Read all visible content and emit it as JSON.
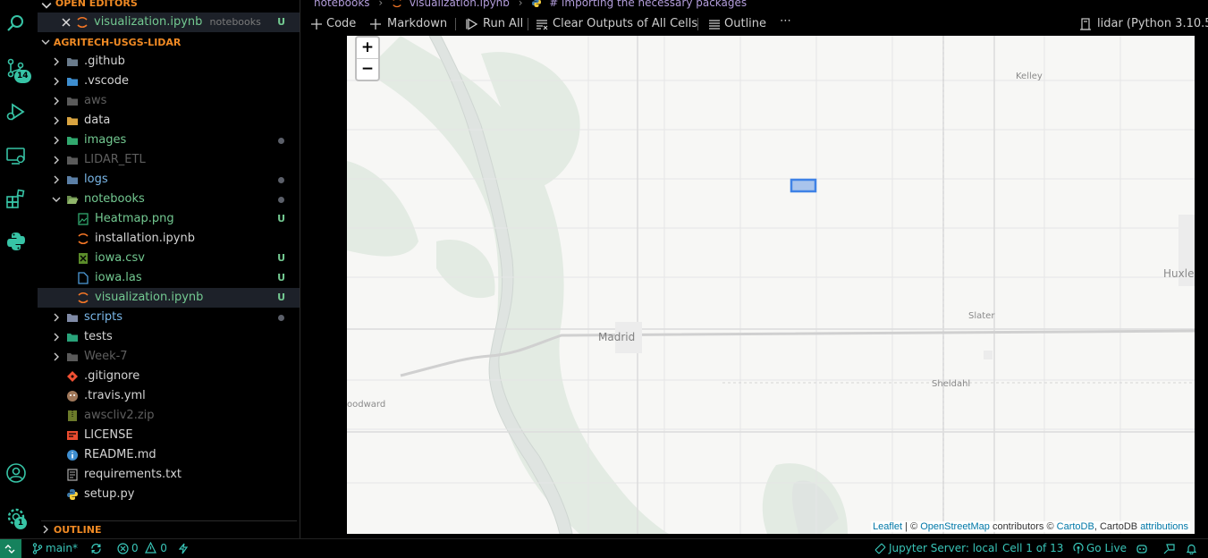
{
  "sidebar": {
    "open_editors_header": "OPEN EDITORS",
    "open_editor": {
      "name": "visualization.ipynb",
      "folder": "notebooks",
      "status": "U"
    },
    "project_header": "AGRITECH-USGS-LIDAR",
    "items": [
      {
        "label": ".github",
        "kind": "folder",
        "color": "white",
        "mark": ""
      },
      {
        "label": ".vscode",
        "kind": "folder",
        "color": "white",
        "mark": ""
      },
      {
        "label": "aws",
        "kind": "folder",
        "color": "dim",
        "mark": ""
      },
      {
        "label": "data",
        "kind": "folder",
        "color": "white",
        "mark": ""
      },
      {
        "label": "images",
        "kind": "folder",
        "color": "green",
        "mark": "dot"
      },
      {
        "label": "LIDAR_ETL",
        "kind": "folder",
        "color": "dim",
        "mark": ""
      },
      {
        "label": "logs",
        "kind": "folder",
        "color": "blue",
        "mark": "dot"
      },
      {
        "label": "notebooks",
        "kind": "folder-open",
        "color": "green",
        "mark": "dot"
      },
      {
        "label": "Heatmap.png",
        "kind": "file-image",
        "color": "green",
        "mark": "U"
      },
      {
        "label": "installation.ipynb",
        "kind": "file-notebook",
        "color": "white",
        "mark": ""
      },
      {
        "label": "iowa.csv",
        "kind": "file-csv",
        "color": "green",
        "mark": "U"
      },
      {
        "label": "iowa.las",
        "kind": "file-generic",
        "color": "green",
        "mark": "U"
      },
      {
        "label": "visualization.ipynb",
        "kind": "file-notebook",
        "color": "green",
        "mark": "U"
      },
      {
        "label": "scripts",
        "kind": "folder",
        "color": "blue",
        "mark": "dot"
      },
      {
        "label": "tests",
        "kind": "folder",
        "color": "white",
        "mark": ""
      },
      {
        "label": "Week-7",
        "kind": "folder",
        "color": "dim",
        "mark": ""
      },
      {
        "label": ".gitignore",
        "kind": "file-git",
        "color": "white",
        "mark": ""
      },
      {
        "label": ".travis.yml",
        "kind": "file-travis",
        "color": "white",
        "mark": ""
      },
      {
        "label": "awscliv2.zip",
        "kind": "file-zip",
        "color": "dim",
        "mark": ""
      },
      {
        "label": "LICENSE",
        "kind": "file-license",
        "color": "white",
        "mark": ""
      },
      {
        "label": "README.md",
        "kind": "file-info",
        "color": "white",
        "mark": ""
      },
      {
        "label": "requirements.txt",
        "kind": "file-text",
        "color": "white",
        "mark": ""
      },
      {
        "label": "setup.py",
        "kind": "file-python",
        "color": "white",
        "mark": ""
      }
    ],
    "outline_header": "OUTLINE"
  },
  "activity": {
    "scm_badge": "14",
    "settings_badge": "1"
  },
  "breadcrumbs": [
    "notebooks",
    "visualization.ipynb",
    "# importing the necessary packages"
  ],
  "toolbar": {
    "code": "Code",
    "markdown": "Markdown",
    "run_all": "Run All",
    "clear_outputs": "Clear Outputs of All Cells",
    "outline": "Outline",
    "more": "⋯",
    "kernel": "lidar (Python 3.10.5)"
  },
  "map": {
    "zoom_in": "+",
    "zoom_out": "−",
    "places": [
      "Kelley",
      "Huxley",
      "Slater",
      "Madrid",
      "Sheldahl",
      "oodward"
    ],
    "attribution": {
      "leaflet": "Leaflet",
      "sep1": " | © ",
      "osm": "OpenStreetMap",
      "mid": " contributors © ",
      "carto": "CartoDB",
      "mid2": ", CartoDB ",
      "attr": "attributions"
    }
  },
  "statusbar": {
    "branch": "main*",
    "errors": "0",
    "warnings": "0",
    "jupyter": "Jupyter Server: local",
    "cell": "Cell 1 of 13",
    "golive": "Go Live"
  },
  "colors": {
    "accent": "#f08a24",
    "status": "#39c5b8",
    "crumbs": "#b39ddb"
  }
}
